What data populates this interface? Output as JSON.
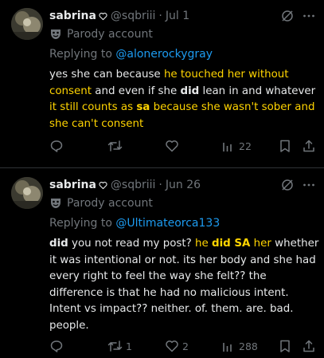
{
  "colors": {
    "background": "#000000",
    "text": "#e7e9ea",
    "muted": "#71767b",
    "link": "#1d9bf0",
    "highlight": "#ffd400",
    "divider": "#2f3336"
  },
  "tweets": [
    {
      "author": {
        "name": "sabrina",
        "name_icon": "heart-outline-icon",
        "handle": "@sqbriii",
        "date": "Jul 1",
        "label": "Parody account",
        "label_icon": "theater-mask-icon"
      },
      "replying_prefix": "Replying to",
      "replying_to": "@alonerockygray",
      "body": {
        "s1": "yes she can because ",
        "s2": "he touched her without consent",
        "s3": " and even if she ",
        "s4": "did",
        "s5": " lean in and whatever ",
        "s6": "it still counts as ",
        "s7": "sa",
        "s8": " because she wasn't sober and she can't consent"
      },
      "actions": {
        "reply": "",
        "retweet": "",
        "like": "",
        "views": "22"
      }
    },
    {
      "author": {
        "name": "sabrina",
        "name_icon": "heart-outline-icon",
        "handle": "@sqbriii",
        "date": "Jun 26",
        "label": "Parody account",
        "label_icon": "theater-mask-icon"
      },
      "replying_prefix": "Replying to",
      "replying_to": "@Ultimateorca133",
      "body": {
        "s1": "did",
        "s2": " you not read my post? ",
        "s3": "he ",
        "s4": "did SA",
        "s5": " her",
        "s6": " whether it was intentional or not. its her body and she had every right to feel the way she felt?? the difference is that he had no malicious intent. Intent vs impact?? neither. of. them. are. bad. people."
      },
      "actions": {
        "reply": "",
        "retweet": "1",
        "like": "2",
        "views": "288"
      }
    }
  ]
}
